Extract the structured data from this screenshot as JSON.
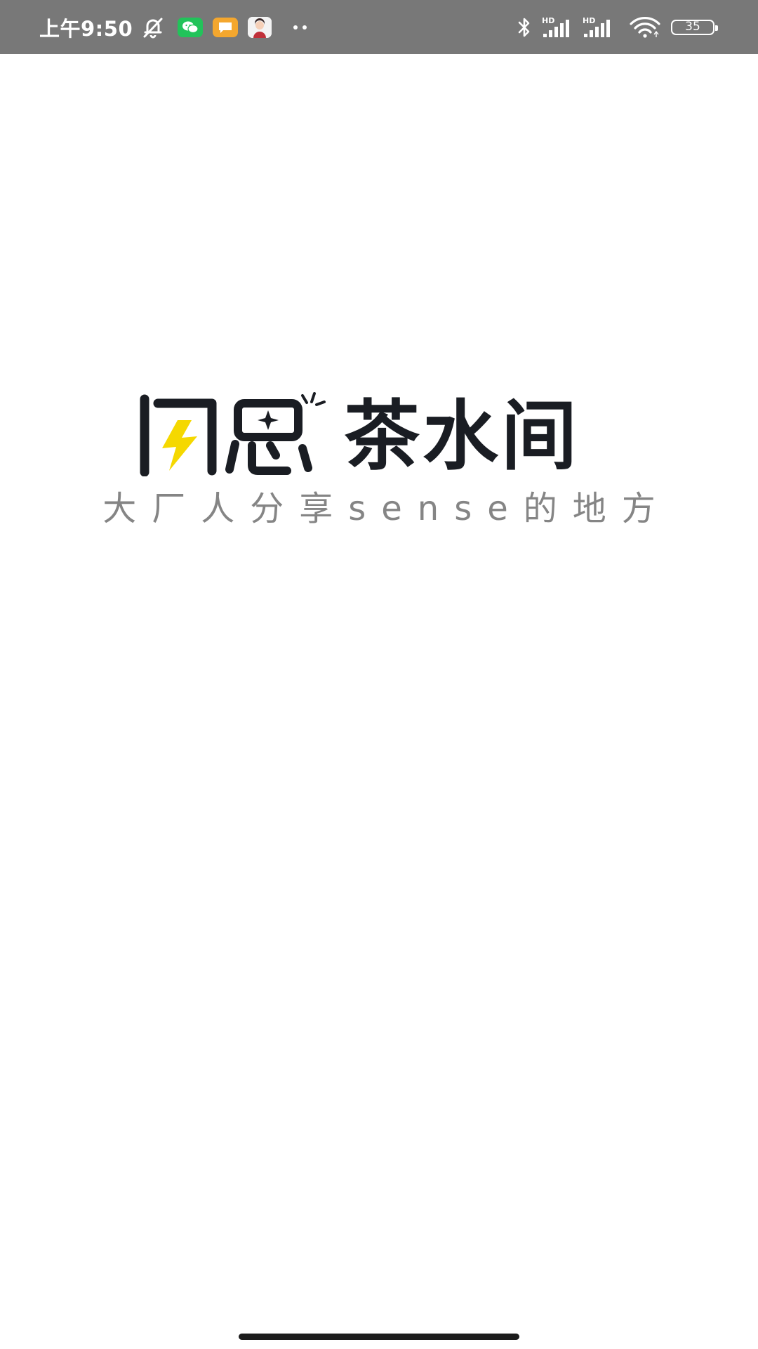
{
  "status_bar": {
    "time": "上午9:50",
    "battery_level": "35",
    "notification_icons": [
      "mute-icon",
      "wechat-icon",
      "message-icon",
      "avatar-icon",
      "more-icon"
    ],
    "system_icons": [
      "bluetooth-icon",
      "signal-hd-icon",
      "signal-hd-icon",
      "wifi-icon",
      "battery-icon"
    ]
  },
  "splash": {
    "brand_name": "茶水间",
    "tagline": "大厂人分享sense的地方"
  },
  "colors": {
    "status_bar_bg": "#787878",
    "brand_text": "#1a1d23",
    "accent_yellow": "#f5d800",
    "tagline_text": "#858585",
    "background": "#ffffff"
  }
}
